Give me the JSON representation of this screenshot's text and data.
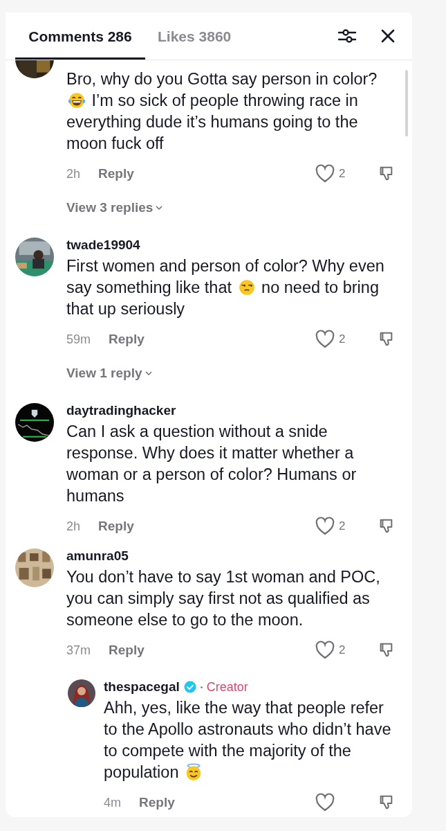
{
  "tabs": [
    {
      "label": "Comments 286",
      "selected": true
    },
    {
      "label": "Likes 3860",
      "selected": false
    }
  ],
  "comments": [
    {
      "cut_top": true,
      "segments": [
        {
          "kind": "text",
          "text": "Bro, why do you Gotta say person in color? "
        },
        {
          "kind": "laugh"
        },
        {
          "kind": "text",
          "text": " I’m so sick of people throwing race in everything dude it’s humans going to the moon fuck off"
        }
      ],
      "time": "2h",
      "reply": "Reply",
      "liked": false,
      "likes": "2",
      "view_replies": "View 3 replies"
    },
    {
      "username": "twade19904",
      "segments": [
        {
          "kind": "text",
          "text": "First women and person of color? Why even say something like that "
        },
        {
          "kind": "unamused"
        },
        {
          "kind": "text",
          "text": " no need to bring that up seriously"
        }
      ],
      "time": "59m",
      "reply": "Reply",
      "liked": false,
      "likes": "2",
      "view_replies": "View 1 reply"
    },
    {
      "username": "daytradinghacker",
      "segments": [
        {
          "kind": "text",
          "text": "Can I ask a question without a snide response. Why does it matter whether a woman or a person of color? Humans or humans"
        }
      ],
      "time": "2h",
      "reply": "Reply",
      "liked": false,
      "likes": "2"
    },
    {
      "username": "amunra05",
      "segments": [
        {
          "kind": "text",
          "text": "You don’t have to say 1st woman and POC, you can simply say first not as qualified as someone else to go to the moon."
        }
      ],
      "time": "37m",
      "reply": "Reply",
      "liked": false,
      "likes": "2",
      "children": [
        {
          "username": "thespacegal",
          "verified": true,
          "badge": "Creator",
          "segments": [
            {
              "kind": "text",
              "text": "Ahh, yes, like the way that people refer to the Apollo astronauts who didn’t have to compete with the majority of the population "
            },
            {
              "kind": "halo"
            }
          ],
          "time": "4m",
          "reply": "Reply",
          "liked": false
        }
      ]
    }
  ]
}
